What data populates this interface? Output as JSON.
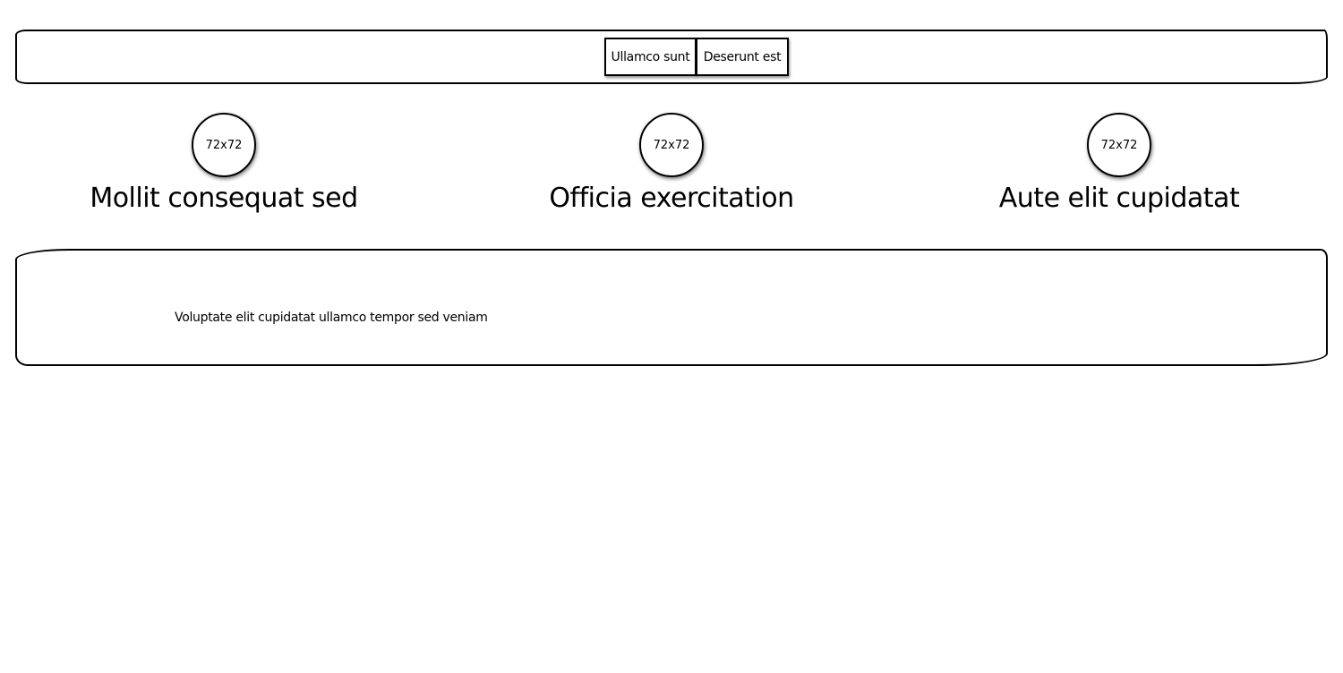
{
  "nav": {
    "buttons": [
      {
        "label": "Ullamco sunt"
      },
      {
        "label": "Deserunt est"
      }
    ]
  },
  "features": [
    {
      "image_label": "72x72",
      "title": "Mollit consequat sed"
    },
    {
      "image_label": "72x72",
      "title": "Officia exercitation"
    },
    {
      "image_label": "72x72",
      "title": "Aute elit cupidatat"
    }
  ],
  "content": {
    "text": "Voluptate elit cupidatat ullamco tempor sed veniam"
  }
}
